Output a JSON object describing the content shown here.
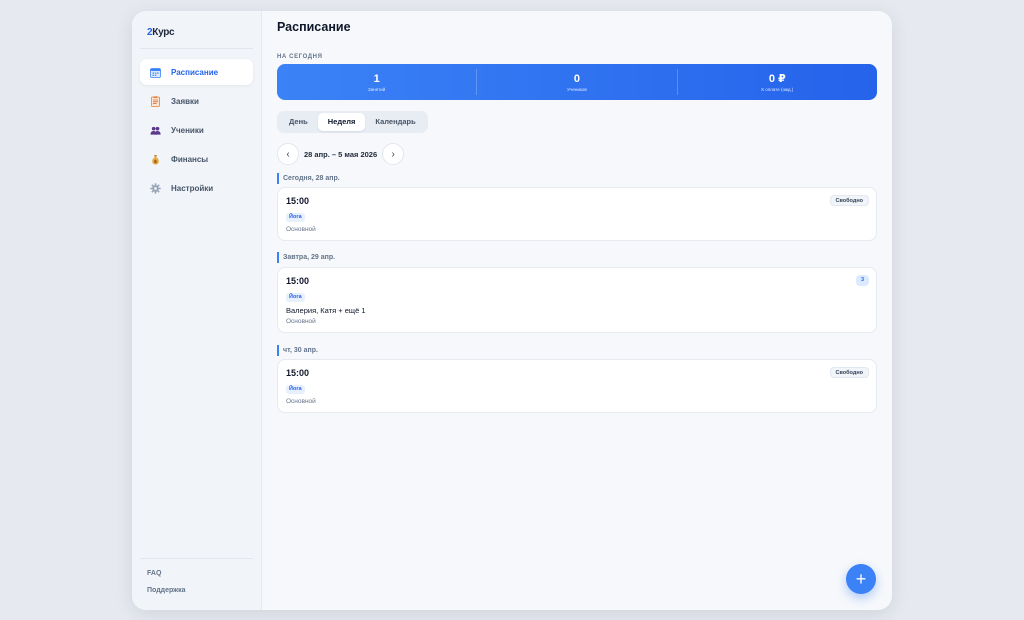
{
  "logo": {
    "part1": "2",
    "part2": "Курс"
  },
  "sidebar": {
    "items": [
      {
        "label": "Расписание",
        "icon": "calendar-icon",
        "active": true
      },
      {
        "label": "Заявки",
        "icon": "clipboard-icon",
        "active": false
      },
      {
        "label": "Ученики",
        "icon": "users-icon",
        "active": false
      },
      {
        "label": "Финансы",
        "icon": "money-bag-icon",
        "active": false
      },
      {
        "label": "Настройки",
        "icon": "gear-icon",
        "active": false
      }
    ],
    "footer": {
      "faq": "FAQ",
      "support": "Поддержка"
    }
  },
  "header": {
    "title": "Расписание"
  },
  "today": {
    "label": "НА СЕГОДНЯ",
    "stats": [
      {
        "value": "1",
        "label": "Занятий"
      },
      {
        "value": "0",
        "label": "Учеников"
      },
      {
        "value": "0 ₽",
        "label": "К оплате (ожд.)"
      }
    ]
  },
  "view_tabs": {
    "day": "День",
    "week": "Неделя",
    "calendar": "Календарь",
    "active": "week"
  },
  "week_nav": {
    "prev": "‹",
    "label": "28 апр. – 5 мая 2026",
    "next": "›"
  },
  "days": [
    {
      "header": "Сегодня, 28 апр.",
      "lessons": [
        {
          "time": "15:00",
          "badge": "Свободно",
          "subject": "Йога",
          "students": "",
          "group": "Основной"
        }
      ]
    },
    {
      "header": "Завтра, 29 апр.",
      "lessons": [
        {
          "time": "15:00",
          "badge": "3",
          "subject": "Йога",
          "students": "Валерия, Катя + ещё 1",
          "group": "Основной"
        }
      ]
    },
    {
      "header": "чт, 30 апр.",
      "lessons": [
        {
          "time": "15:00",
          "badge": "Свободно",
          "subject": "Йога",
          "students": "",
          "group": "Основной"
        }
      ]
    }
  ],
  "fab": {
    "label": "+"
  },
  "colors": {
    "accent": "#3b82f6",
    "accent_dark": "#2563eb",
    "background": "#e6eaf0"
  }
}
